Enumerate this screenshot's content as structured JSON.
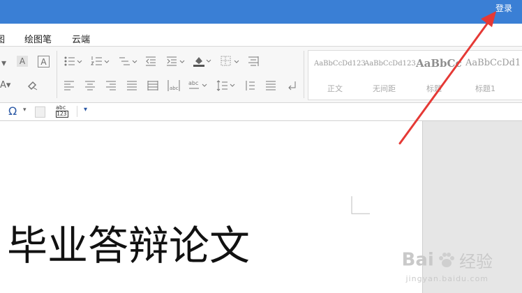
{
  "window": {
    "login_label": "登录",
    "accent_color": "#3a7fd5"
  },
  "menu": {
    "items": [
      "图",
      "绘图笔",
      "云端"
    ]
  },
  "styles_gallery": [
    {
      "sample": "AaBbCcDd123",
      "name": "正文"
    },
    {
      "sample": "AaBbCcDd123",
      "name": "无间距"
    },
    {
      "sample": "AaBbCcD",
      "name": "标题"
    },
    {
      "sample": "AaBbCcDd1",
      "name": "标题1"
    }
  ],
  "quickbar": {
    "abc_top": "abc",
    "abc_bottom": "123"
  },
  "document": {
    "title": "毕业答辩论文"
  },
  "watermark": {
    "brand_left": "Bai",
    "brand_right": "经验",
    "url": "jingyan.baidu.com"
  },
  "annotation": {
    "arrow_color": "#e53935"
  }
}
